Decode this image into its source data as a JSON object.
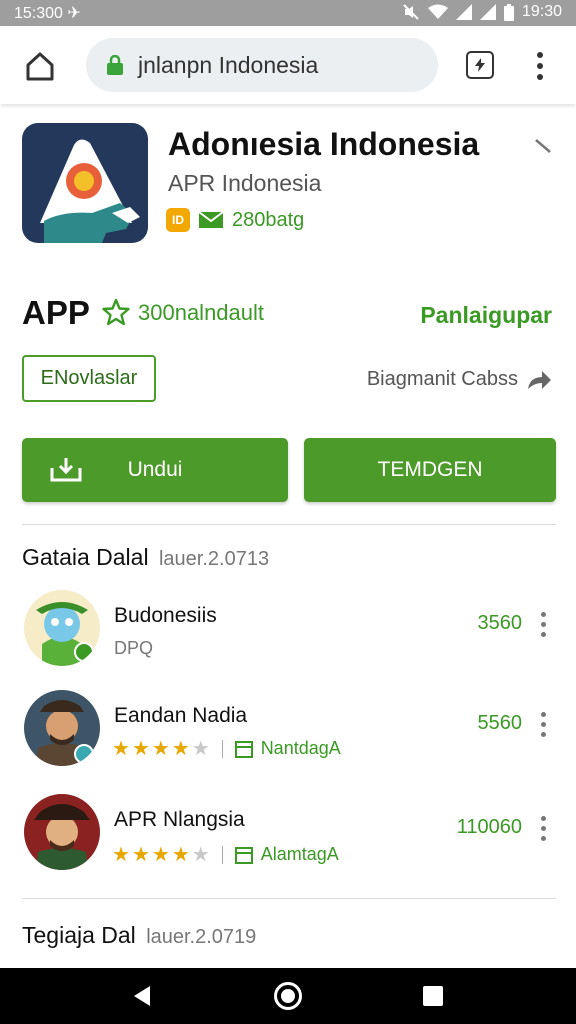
{
  "status_bar": {
    "left": "15:300",
    "time": "19:30"
  },
  "browser": {
    "url": "jnlanpn Indonesia",
    "tabs_count": ""
  },
  "app": {
    "title": "Adonıesia Indonesia",
    "developer": "APR Indonesia",
    "badge": "ID",
    "meta": "280batg",
    "label": "APP",
    "rating_text": "300nalndault",
    "publisher_link": "Panlaigupar",
    "outline_button": "ENovlaslar",
    "link_text": "Biagmanit Cabss",
    "install_button": "Undui",
    "second_button": "TEMDGEN"
  },
  "section1": {
    "title": "Gataia Dalal",
    "subtitle": "lauer.2.0713"
  },
  "items": [
    {
      "name": "Budonesiis",
      "sub": "DPQ",
      "count": "3560",
      "rating": null,
      "category": ""
    },
    {
      "name": "Eandan Nadia",
      "sub": "",
      "count": "5560",
      "rating": 4,
      "category": "NantdagA"
    },
    {
      "name": "APR Nlangsia",
      "sub": "",
      "count": "110060",
      "rating": 4,
      "category": "AlamtagA"
    }
  ],
  "section2": {
    "title": "Tegiaja Dal",
    "subtitle": "lauer.2.0719"
  },
  "colors": {
    "accent_green": "#4c9b2a",
    "text_green": "#3a9a24",
    "status_bar": "#9e9e9e",
    "star": "#e6a700"
  }
}
